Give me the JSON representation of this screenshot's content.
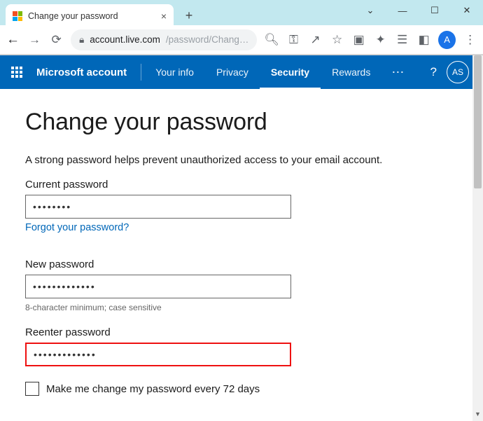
{
  "browser": {
    "tab_title": "Change your password",
    "url_host": "account.live.com",
    "url_path": "/password/Chang…",
    "profile_initial": "A"
  },
  "nav": {
    "brand": "Microsoft account",
    "items": [
      "Your info",
      "Privacy",
      "Security",
      "Rewards"
    ],
    "active_index": 2,
    "avatar_initials": "AS"
  },
  "page": {
    "heading": "Change your password",
    "subtitle": "A strong password helps prevent unauthorized access to your email account.",
    "current_label": "Current password",
    "current_value": "••••••••",
    "forgot_link": "Forgot your password?",
    "new_label": "New password",
    "new_value": "•••••••••••••",
    "hint": "8-character minimum; case sensitive",
    "reenter_label": "Reenter password",
    "reenter_value": "•••••••••••••",
    "checkbox_label": "Make me change my password every 72 days"
  }
}
